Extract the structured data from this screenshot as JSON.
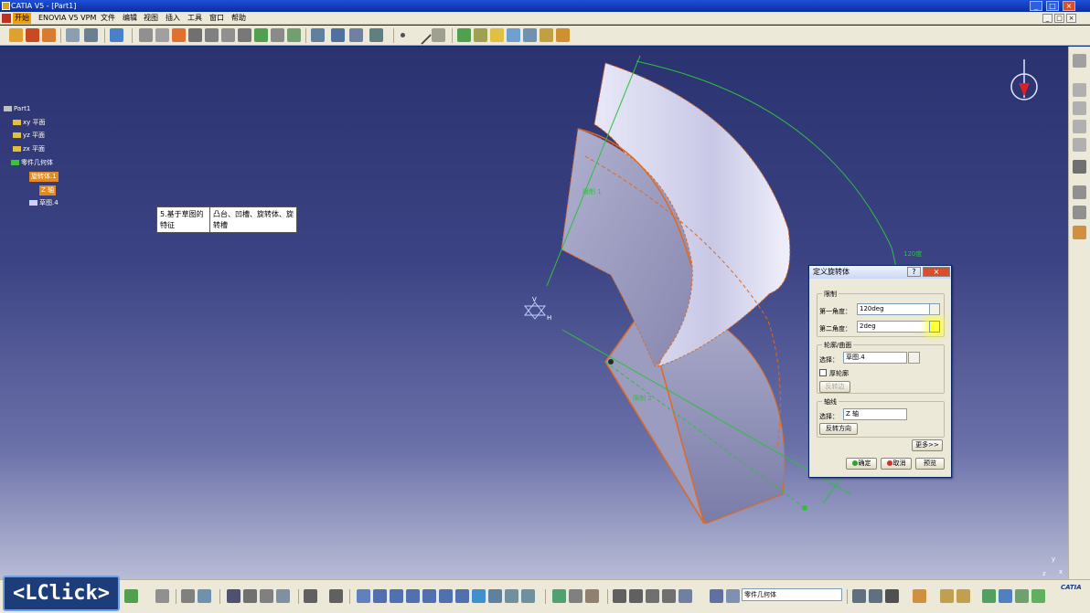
{
  "window": {
    "title": "CATIA V5 - [Part1]"
  },
  "menu": {
    "items": [
      "开始",
      "ENOVIA V5 VPM",
      "文件",
      "编辑",
      "视图",
      "插入",
      "工具",
      "窗口",
      "帮助"
    ],
    "active_index": 0
  },
  "tree": {
    "root": "Part1",
    "items": [
      {
        "label": "xy 平面"
      },
      {
        "label": "yz 平面"
      },
      {
        "label": "zx 平面"
      },
      {
        "label": "零件几何体"
      },
      {
        "label": "旋转体.1",
        "selected": true
      },
      {
        "label": "Z 轴",
        "selected": true
      },
      {
        "label": "草图.4"
      }
    ]
  },
  "tooltip": {
    "col1": "5.基于草图的特征",
    "col2": "凸台、凹槽、旋转体、旋转槽"
  },
  "viewport_labels": {
    "limit1": "限制 1",
    "limit2": "限制 2",
    "angle": "120度",
    "axis_v": "V",
    "axis_h": "H",
    "compass_x": "x",
    "compass_y": "y",
    "compass_z": "z"
  },
  "dialog": {
    "title": "定义旋转体",
    "help_btn": "?",
    "close_btn": "×",
    "limits_group": "限制",
    "first_angle_label": "第一角度：",
    "first_angle_value": "120deg",
    "second_angle_label": "第二角度：",
    "second_angle_value": "2deg",
    "profile_group": "轮廓/曲面",
    "profile_select_label": "选择：",
    "profile_select_value": "草图.4",
    "thick_profile_label": "厚轮廓",
    "thick_profile_checked": false,
    "reverse_side_label": "反转边",
    "axis_group": "轴线",
    "axis_select_label": "选择：",
    "axis_select_value": "Z 轴",
    "reverse_direction_label": "反转方向",
    "more_label": "更多>>",
    "ok_label": "确定",
    "cancel_label": "取消",
    "preview_label": "预览"
  },
  "bottom": {
    "combo_value": "零件几何体"
  },
  "overlay": {
    "lclick": "<LClick>"
  },
  "brand": {
    "logo": "CATIA"
  },
  "colors": {
    "titlebar": "#1e4fd8",
    "chrome": "#ece9d8",
    "selection": "#e08a20",
    "highlight_yellow": "#ffff40",
    "limit_green": "#2fbf3f"
  }
}
